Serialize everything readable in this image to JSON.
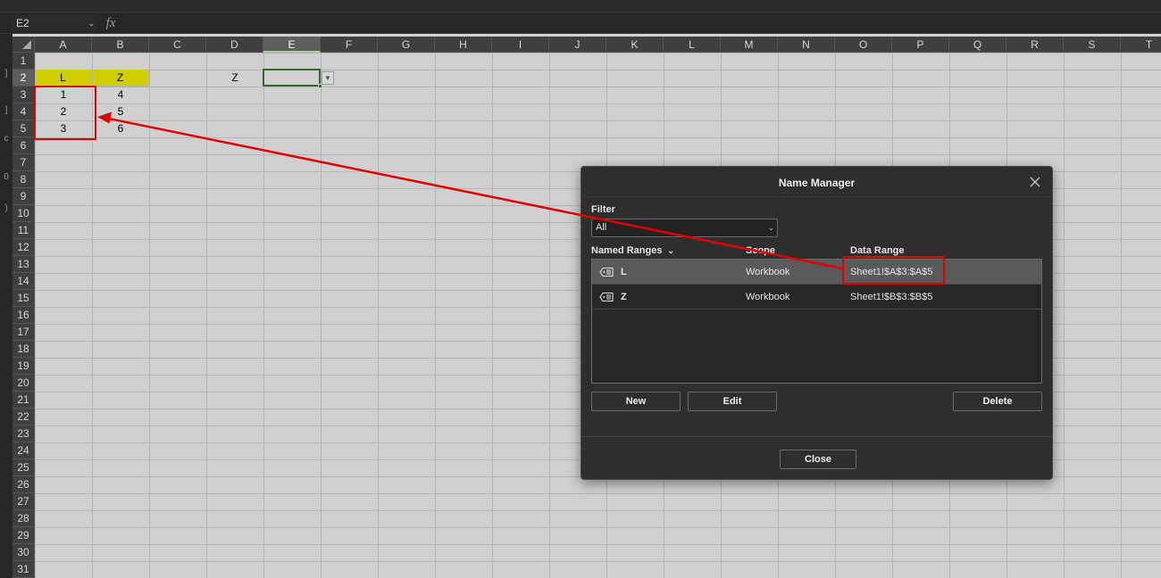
{
  "formula_bar": {
    "name_box": "E2",
    "fx_label": "fx",
    "formula": ""
  },
  "left_panel_glyphs": [
    "]",
    "]",
    "c",
    "0",
    ")"
  ],
  "columns": [
    "A",
    "B",
    "C",
    "D",
    "E",
    "F",
    "G",
    "H",
    "I",
    "J",
    "K",
    "L",
    "M",
    "N",
    "O",
    "P",
    "Q",
    "R",
    "S",
    "T"
  ],
  "selected_column": "E",
  "rows": [
    "1",
    "2",
    "3",
    "4",
    "5",
    "6",
    "7",
    "8",
    "9",
    "10",
    "11",
    "12",
    "13",
    "14",
    "15",
    "16",
    "17",
    "18",
    "19",
    "20",
    "21",
    "22",
    "23",
    "24",
    "25",
    "26",
    "27",
    "28",
    "29",
    "30",
    "31"
  ],
  "selected_row": "2",
  "cells": {
    "A2": "L",
    "B2": "Z",
    "A3": "1",
    "B3": "4",
    "A4": "2",
    "B4": "5",
    "A5": "3",
    "B5": "6",
    "D2": "Z",
    "E2": ""
  },
  "highlight_color": "#cfcf00",
  "annotation_color": "#e00000",
  "dialog": {
    "title": "Name Manager",
    "filter_label": "Filter",
    "filter_value": "All",
    "headers": {
      "named_ranges": "Named Ranges",
      "sort_icon": "⌄",
      "scope": "Scope",
      "data_range": "Data Range"
    },
    "items": [
      {
        "name": "L",
        "scope": "Workbook",
        "range": "Sheet1!$A$3:$A$5",
        "icon": "name-tag-icon"
      },
      {
        "name": "Z",
        "scope": "Workbook",
        "range": "Sheet1!$B$3:$B$5",
        "icon": "name-tag-icon"
      }
    ],
    "buttons": {
      "new": "New",
      "edit": "Edit",
      "delete": "Delete",
      "close": "Close"
    }
  }
}
